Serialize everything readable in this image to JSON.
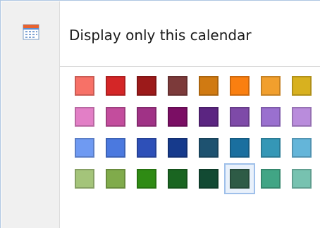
{
  "menu": {
    "item": {
      "label": "Display only this calendar",
      "icon": "calendar-icon"
    },
    "palette": {
      "selected": "#2e5b46",
      "rows": [
        [
          "#f77167",
          "#d42627",
          "#9c1a1a",
          "#7c3a3a",
          "#d07a12",
          "#fa7f10",
          "#f19f2d",
          "#d8b11f"
        ],
        [
          "#e27fc6",
          "#c34d9d",
          "#a03286",
          "#7b0e64",
          "#5b2581",
          "#7e4aa8",
          "#9a70cf",
          "#b98cdc"
        ],
        [
          "#6f9af2",
          "#4b79df",
          "#2e50b8",
          "#163a8c",
          "#1e5270",
          "#1a6f9f",
          "#3597b6",
          "#64b5d9"
        ],
        [
          "#a4c47a",
          "#80ab4b",
          "#2f8b14",
          "#1a6521",
          "#124a33",
          "#2e5b46",
          "#41a585",
          "#77c2b0"
        ]
      ]
    }
  }
}
